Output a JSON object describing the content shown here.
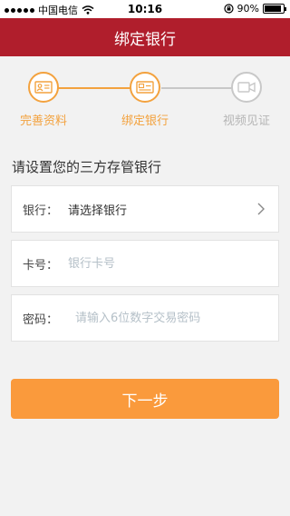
{
  "status_bar": {
    "carrier": "中国电信",
    "time": "10:16",
    "battery": "90%",
    "battery_level": 0.9
  },
  "nav": {
    "title": "绑定银行"
  },
  "steps": [
    {
      "label": "完善资料",
      "icon": "id-card-icon",
      "state": "done"
    },
    {
      "label": "绑定银行",
      "icon": "bank-card-icon",
      "state": "active"
    },
    {
      "label": "视频见证",
      "icon": "video-camera-icon",
      "state": "pending"
    }
  ],
  "colors": {
    "brand": "#b01e2c",
    "accent": "#f3a23e",
    "button": "#fa9a3c",
    "inactive": "#c8c8c8"
  },
  "section_title": "请设置您的三方存管银行",
  "form": {
    "bank": {
      "label": "银行：",
      "value": "请选择银行"
    },
    "card": {
      "label": "卡号：",
      "placeholder": "银行卡号"
    },
    "password": {
      "label": "密码：",
      "placeholder": "请输入6位数字交易密码"
    }
  },
  "submit_label": "下一步"
}
